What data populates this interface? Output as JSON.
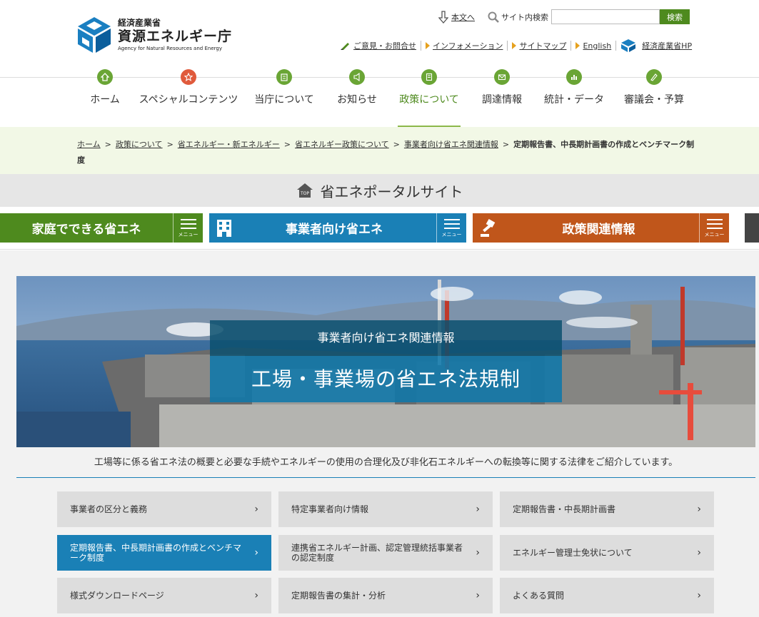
{
  "header": {
    "logo_ministry": "経済産業省",
    "logo_name": "資源エネルギー庁",
    "logo_en": "Agency for Natural Resources and Energy",
    "skip_link": "本文へ",
    "search_label": "サイト内検索",
    "search_placeholder": "",
    "search_button": "検索",
    "links": {
      "contact": "ご意見・お問合せ",
      "information": "インフォメーション",
      "sitemap": "サイトマップ",
      "english": "English",
      "meti": "経済産業省HP"
    }
  },
  "gnav": [
    {
      "label": "ホーム",
      "icon": "home-icon",
      "color": "#6aa535"
    },
    {
      "label": "スペシャルコンテンツ",
      "icon": "star-icon",
      "color": "#e05a3c"
    },
    {
      "label": "当庁について",
      "icon": "building-icon",
      "color": "#6aa535"
    },
    {
      "label": "お知らせ",
      "icon": "megaphone-icon",
      "color": "#6aa535"
    },
    {
      "label": "政策について",
      "icon": "document-icon",
      "color": "#6aa535"
    },
    {
      "label": "調達情報",
      "icon": "mail-icon",
      "color": "#6aa535"
    },
    {
      "label": "統計・データ",
      "icon": "chart-icon",
      "color": "#6aa535"
    },
    {
      "label": "審議会・予算",
      "icon": "pencil-icon",
      "color": "#6aa535"
    }
  ],
  "breadcrumb": {
    "items": [
      "ホーム",
      "政策について",
      "省エネルギー・新エネルギー",
      "省エネルギー政策について",
      "事業者向け省エネ関連情報"
    ],
    "current": "定期報告書、中長期計画書の作成とベンチマーク制度",
    "separator": ">"
  },
  "portal": {
    "title": "省エネポータルサイト",
    "top_label": "TOP"
  },
  "categories": {
    "home": "家庭でできる省エネ",
    "biz": "事業者向け省エネ",
    "policy": "政策関連情報",
    "menu_label": "メニュー"
  },
  "hero": {
    "subtitle": "事業者向け省エネ関連情報",
    "title": "工場・事業場の省エネ法規制"
  },
  "intro": "工場等に係る省エネ法の概要と必要な手続やエネルギーの使用の合理化及び非化石エネルギーへの転換等に関する法律をご紹介しています。",
  "cards": [
    "事業者の区分と義務",
    "特定事業者向け情報",
    "定期報告書・中長期計画書",
    "定期報告書、中長期計画書の作成とベンチマーク制度",
    "連携省エネルギー計画、認定管理統括事業者の認定制度",
    "エネルギー管理士免状について",
    "様式ダウンロードページ",
    "定期報告書の集計・分析",
    "よくある質問"
  ],
  "chevron": "›",
  "colors": {
    "green": "#4e8a1e",
    "blue": "#1a80b6",
    "orange": "#c0561b"
  }
}
